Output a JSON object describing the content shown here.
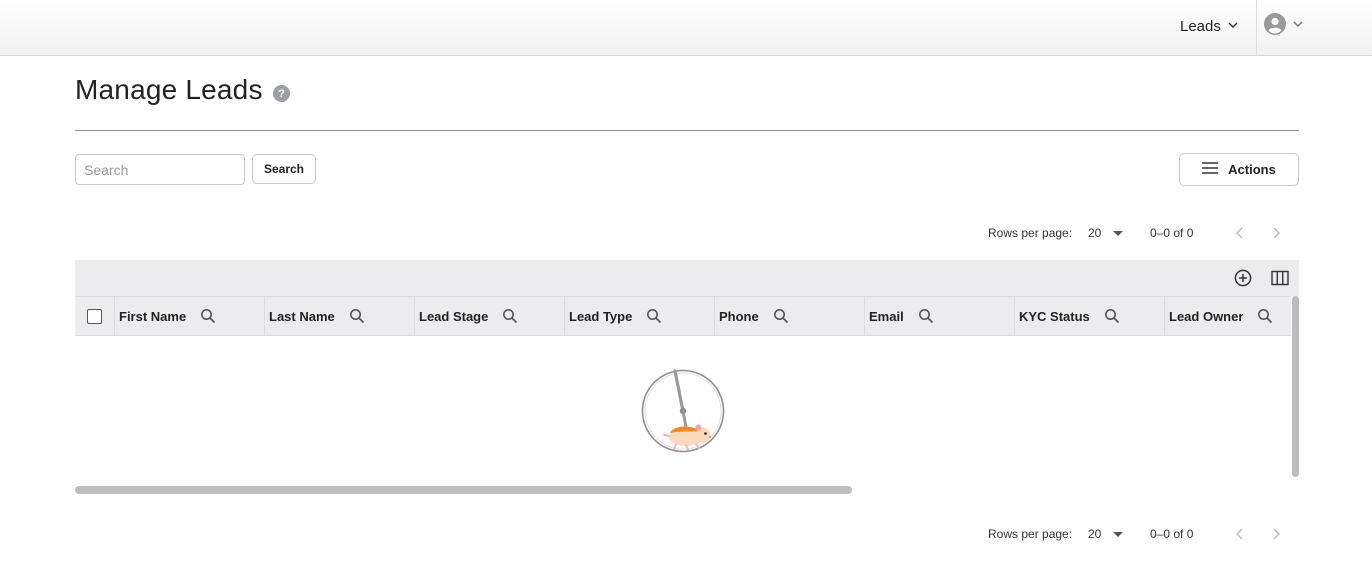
{
  "header": {
    "nav_menu_label": "Leads"
  },
  "page": {
    "title": "Manage Leads",
    "help_glyph": "?"
  },
  "search": {
    "placeholder": "Search",
    "button_label": "Search"
  },
  "actions": {
    "label": "Actions"
  },
  "pagination_top": {
    "rows_per_page_label": "Rows per page:",
    "rows_per_page_value": "20",
    "range_text": "0–0 of 0"
  },
  "pagination_bottom": {
    "rows_per_page_label": "Rows per page:",
    "rows_per_page_value": "20",
    "range_text": "0–0 of 0"
  },
  "table": {
    "columns": [
      {
        "label": "First Name"
      },
      {
        "label": "Last Name"
      },
      {
        "label": "Lead Stage"
      },
      {
        "label": "Lead Type"
      },
      {
        "label": "Phone"
      },
      {
        "label": "Email"
      },
      {
        "label": "KYC Status"
      },
      {
        "label": "Lead Owner"
      }
    ],
    "rows": []
  },
  "icons": {
    "nav_chevron": "chevron-down-icon",
    "user": "user-circle-icon",
    "help": "help-circle-icon",
    "actions": "menu-icon",
    "add_column": "add-circle-icon",
    "columns": "view-columns-icon",
    "column_search": "search-icon",
    "loading": "hamster-wheel-loader"
  },
  "colors": {
    "header_bg": "#ececee",
    "help_icon": "#9aa0a6",
    "scrollbar": "#bdbdbd",
    "loader_accent": "#f08a24"
  }
}
